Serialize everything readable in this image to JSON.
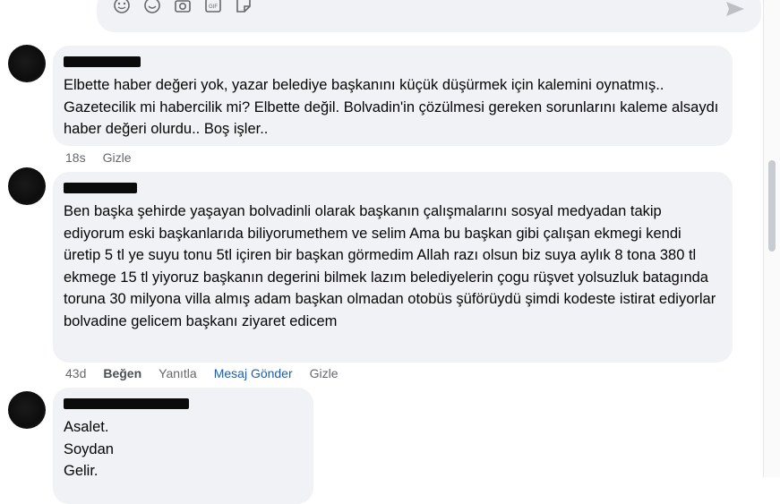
{
  "composer": {
    "icons": [
      "emoji-icon",
      "smile-icon",
      "camera-icon",
      "gif-icon",
      "sticker-icon"
    ],
    "send_icon": "send-icon"
  },
  "comments": [
    {
      "text": "Elbette haber değeri yok, yazar belediye başkanını küçük düşürmek için kalemini oynatmış.. Gazetecilik mi habercilik mi? Elbette değil. Bolvadin'in çözülmesi gereken sorunlarını kaleme alsaydı haber değeri olurdu.. Boş işler..",
      "time": "18s",
      "hide": "Gizle"
    },
    {
      "text": "Ben başka şehirde yaşayan bolvadinli olarak başkanın çalışmalarını sosyal medyadan takip ediyorum eski başkanlarıda biliyorumethem ve selim Ama bu başkan gibi çalışan ekmegi kendi üretip 5 tl ye suyu tonu 5tl içiren bir başkan görmedim Allah razı olsun biz suya aylık 8 tona 380 tl ekmege 15 tl yiyoruz başkanın degerini bilmek lazım belediyelerin çogu rüşvet yolsuzluk batagında toruna 30 milyona villa almış adam başkan olmadan otobüs şüförüydü şimdi kodeste istirat ediyorlar bolvadine gelicem başkanı ziyaret edicem",
      "time": "43d",
      "like": "Beğen",
      "reply": "Yanıtla",
      "message": "Mesaj Gönder",
      "hide": "Gizle"
    },
    {
      "lines": [
        "Asalet.",
        "Soydan",
        "Gelir."
      ]
    }
  ],
  "colors": {
    "bubble": "#f0f2f5",
    "meta_text": "#65676b",
    "link_blue": "#1a5fb4"
  }
}
